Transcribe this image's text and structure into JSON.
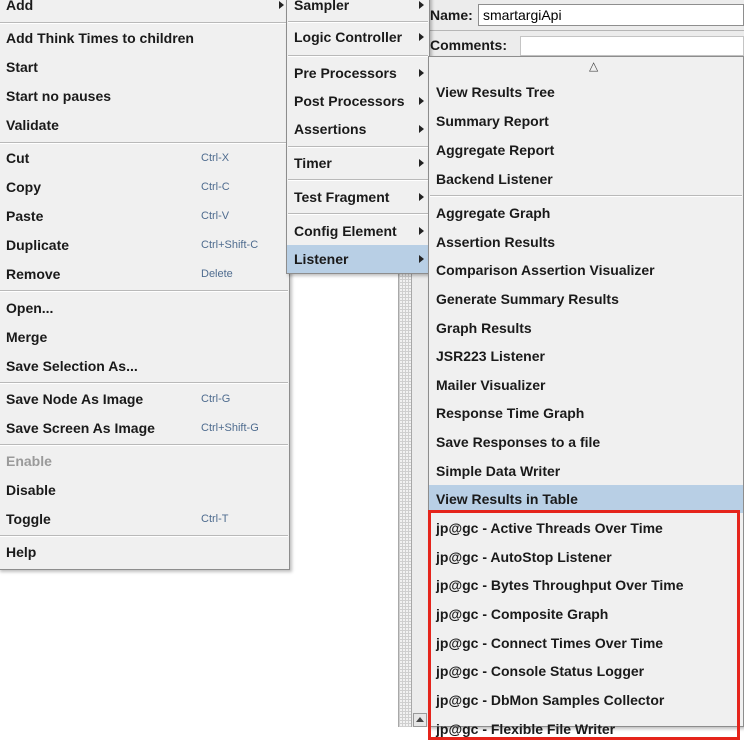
{
  "form": {
    "name_label": "Name:",
    "name_value": "smartargiApi",
    "comments_label": "Comments:"
  },
  "context_menu": {
    "add": "Add",
    "items": [
      {
        "label": "Add Think Times to children",
        "shortcut": ""
      },
      {
        "label": "Start",
        "shortcut": ""
      },
      {
        "label": "Start no pauses",
        "shortcut": ""
      },
      {
        "label": "Validate",
        "shortcut": ""
      },
      {
        "label": "Cut",
        "shortcut": "Ctrl-X"
      },
      {
        "label": "Copy",
        "shortcut": "Ctrl-C"
      },
      {
        "label": "Paste",
        "shortcut": "Ctrl-V"
      },
      {
        "label": "Duplicate",
        "shortcut": "Ctrl+Shift-C"
      },
      {
        "label": "Remove",
        "shortcut": "Delete"
      },
      {
        "label": "Open...",
        "shortcut": ""
      },
      {
        "label": "Merge",
        "shortcut": ""
      },
      {
        "label": "Save Selection As...",
        "shortcut": ""
      },
      {
        "label": "Save Node As Image",
        "shortcut": "Ctrl-G"
      },
      {
        "label": "Save Screen As Image",
        "shortcut": "Ctrl+Shift-G"
      },
      {
        "label": "Enable",
        "shortcut": "",
        "disabled": true
      },
      {
        "label": "Disable",
        "shortcut": ""
      },
      {
        "label": "Toggle",
        "shortcut": "Ctrl-T"
      },
      {
        "label": "Help",
        "shortcut": ""
      }
    ]
  },
  "add_submenu": {
    "items": [
      "Sampler",
      "Logic Controller",
      "Pre Processors",
      "Post Processors",
      "Assertions",
      "Timer",
      "Test Fragment",
      "Config Element",
      "Listener"
    ],
    "selected": "Listener"
  },
  "listener_submenu": {
    "scroll_up_glyph": "△",
    "items": [
      "View Results Tree",
      "Summary Report",
      "Aggregate Report",
      "Backend Listener",
      "Aggregate Graph",
      "Assertion Results",
      "Comparison Assertion Visualizer",
      "Generate Summary Results",
      "Graph Results",
      "JSR223 Listener",
      "Mailer Visualizer",
      "Response Time Graph",
      "Save Responses to a file",
      "Simple Data Writer",
      "View Results in Table",
      "jp@gc - Active Threads Over Time",
      "jp@gc - AutoStop Listener",
      "jp@gc - Bytes Throughput Over Time",
      "jp@gc - Composite Graph",
      "jp@gc - Connect Times Over Time",
      "jp@gc - Console Status Logger",
      "jp@gc - DbMon Samples Collector",
      "jp@gc - Flexible File Writer"
    ],
    "selected": "View Results in Table"
  },
  "colors": {
    "selection": "#b8cfe5",
    "highlight_border": "#e5241b",
    "menu_bg": "#f0f0f0"
  }
}
